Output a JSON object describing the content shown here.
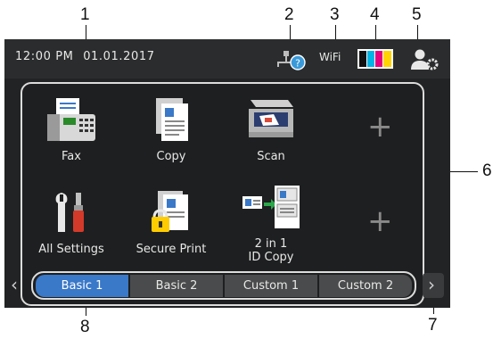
{
  "callouts": {
    "n1": "1",
    "n2": "2",
    "n3": "3",
    "n4": "4",
    "n5": "5",
    "n6": "6",
    "n7": "7",
    "n8": "8"
  },
  "status": {
    "time": "12:00 PM",
    "date": "01.01.2017",
    "wifi": "WiFi"
  },
  "icons": {
    "wired": "wired-lan-unknown-icon",
    "ink": "ink-levels-icon",
    "admin": "admin-settings-icon"
  },
  "shortcuts": [
    {
      "label": "Fax",
      "icon": "fax-icon"
    },
    {
      "label": "Copy",
      "icon": "copy-icon"
    },
    {
      "label": "Scan",
      "icon": "scan-icon"
    },
    {
      "label": "All Settings",
      "icon": "wrench-screwdriver-icon"
    },
    {
      "label": "Secure Print",
      "icon": "secure-print-lock-icon"
    },
    {
      "label": "2 in 1",
      "label2": "ID Copy",
      "icon": "id-card-copy-icon"
    }
  ],
  "tabs": [
    {
      "label": "Basic 1",
      "active": true
    },
    {
      "label": "Basic 2",
      "active": false
    },
    {
      "label": "Custom 1",
      "active": false
    },
    {
      "label": "Custom 2",
      "active": false
    }
  ],
  "nav": {
    "prev": "‹",
    "next": "›"
  },
  "colors": {
    "accent": "#3a78c8",
    "screen": "#222324",
    "cyan": "#00b4e6",
    "magenta": "#e6007e",
    "yellow": "#ffd400"
  }
}
